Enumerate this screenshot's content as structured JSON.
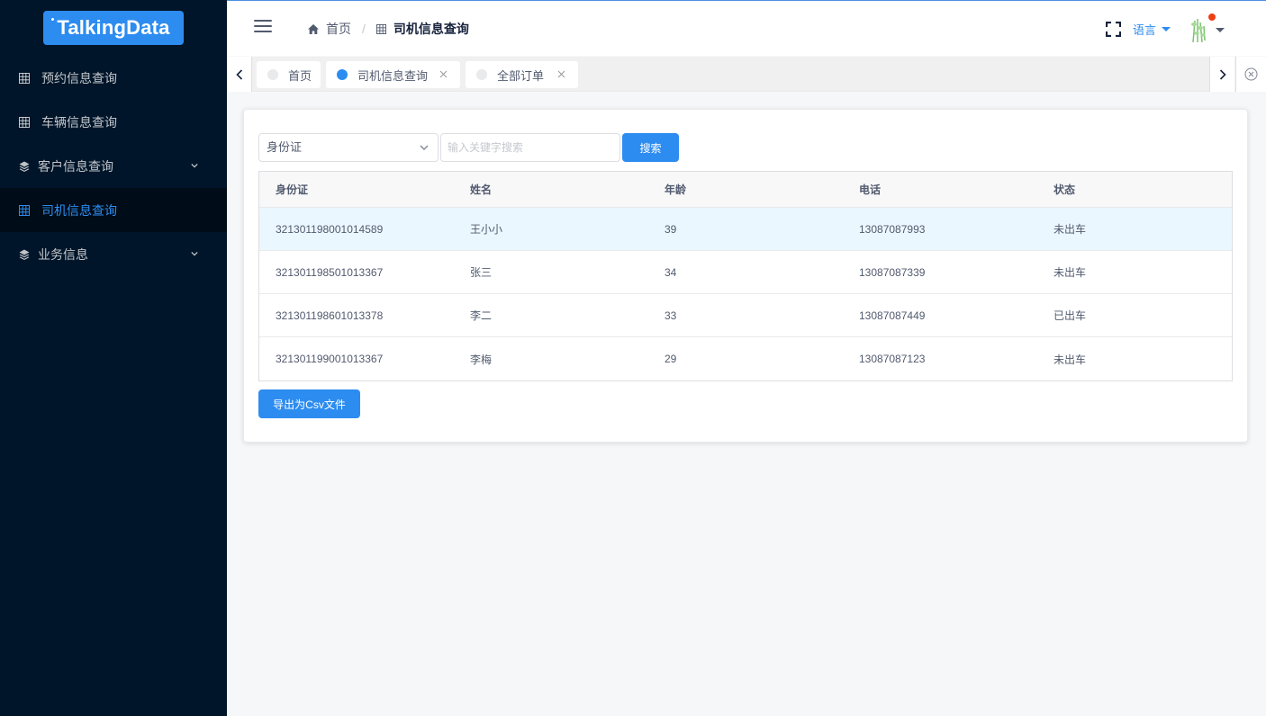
{
  "brand": {
    "name": "TalkingData"
  },
  "sidebar": {
    "items": [
      {
        "label": "预约信息查询",
        "icon": "grid-icon",
        "has_children": false
      },
      {
        "label": "车辆信息查询",
        "icon": "grid-icon",
        "has_children": false
      },
      {
        "label": "客户信息查询",
        "icon": "stack-icon",
        "has_children": true
      },
      {
        "label": "司机信息查询",
        "icon": "grid-icon",
        "has_children": false,
        "active": true
      },
      {
        "label": "业务信息",
        "icon": "stack-icon",
        "has_children": true
      }
    ]
  },
  "header": {
    "breadcrumb": [
      {
        "label": "首页",
        "icon": "home-icon"
      },
      {
        "label": "司机信息查询",
        "icon": "grid-icon"
      }
    ],
    "language_label": "语言"
  },
  "tabs": [
    {
      "label": "首页",
      "active": false,
      "closable": false
    },
    {
      "label": "司机信息查询",
      "active": true,
      "closable": true
    },
    {
      "label": "全部订单",
      "active": false,
      "closable": true
    }
  ],
  "filter": {
    "select_value": "身份证",
    "search_placeholder": "输入关键字搜索",
    "search_button": "搜索"
  },
  "table": {
    "columns": [
      "身份证",
      "姓名",
      "年龄",
      "电话",
      "状态"
    ],
    "rows": [
      [
        "321301198001014589",
        "王小小",
        "39",
        "13087087993",
        "未出车"
      ],
      [
        "321301198501013367",
        "张三",
        "34",
        "13087087339",
        "未出车"
      ],
      [
        "321301198601013378",
        "李二",
        "33",
        "13087087449",
        "已出车"
      ],
      [
        "321301199001013367",
        "李梅",
        "29",
        "13087087123",
        "未出车"
      ]
    ],
    "highlighted_row": 0
  },
  "export_button": "导出为Csv文件",
  "colors": {
    "sidebar_bg": "#001529",
    "accent": "#2d8cf0",
    "notification_dot": "#ed4014"
  }
}
